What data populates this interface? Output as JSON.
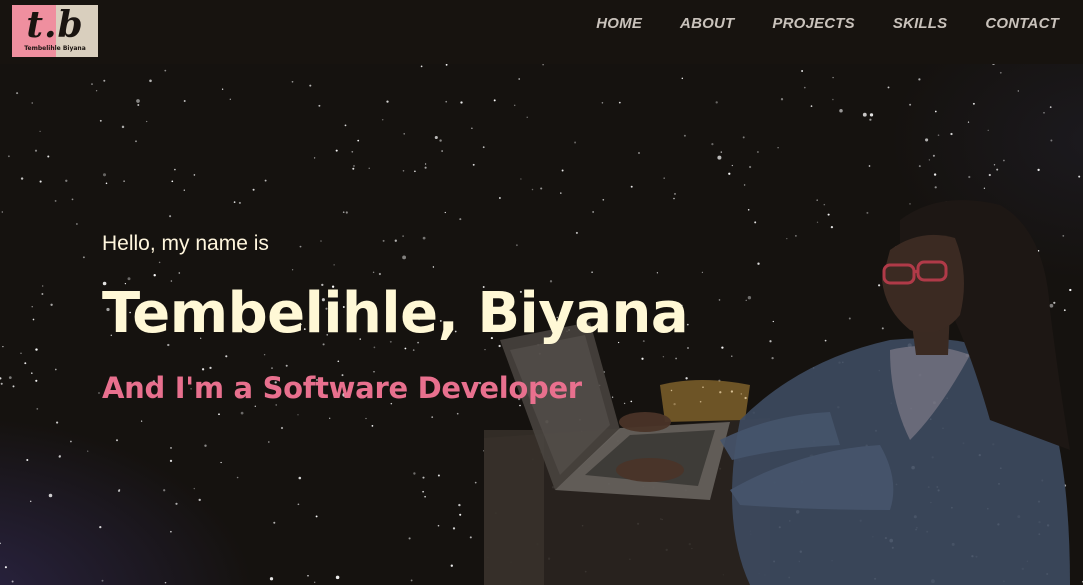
{
  "brand": {
    "logo_mark": "t.b",
    "logo_name": "Tembelihle Biyana",
    "colors": {
      "logo_left": "#ef8f9f",
      "logo_right": "#d9cfbe"
    }
  },
  "nav": {
    "items": [
      {
        "label": "HOME"
      },
      {
        "label": "ABOUT"
      },
      {
        "label": "PROJECTS"
      },
      {
        "label": "SKILLS"
      },
      {
        "label": "CONTACT"
      }
    ]
  },
  "hero": {
    "greeting": "Hello, my name is",
    "name": "Tembelihle, Biyana",
    "role": "And I'm a Software Developer",
    "colors": {
      "name": "#fff8d6",
      "role": "#e8708e",
      "background": "#15120f"
    }
  },
  "media": {
    "hero_image": "person-at-laptop-illustration"
  }
}
